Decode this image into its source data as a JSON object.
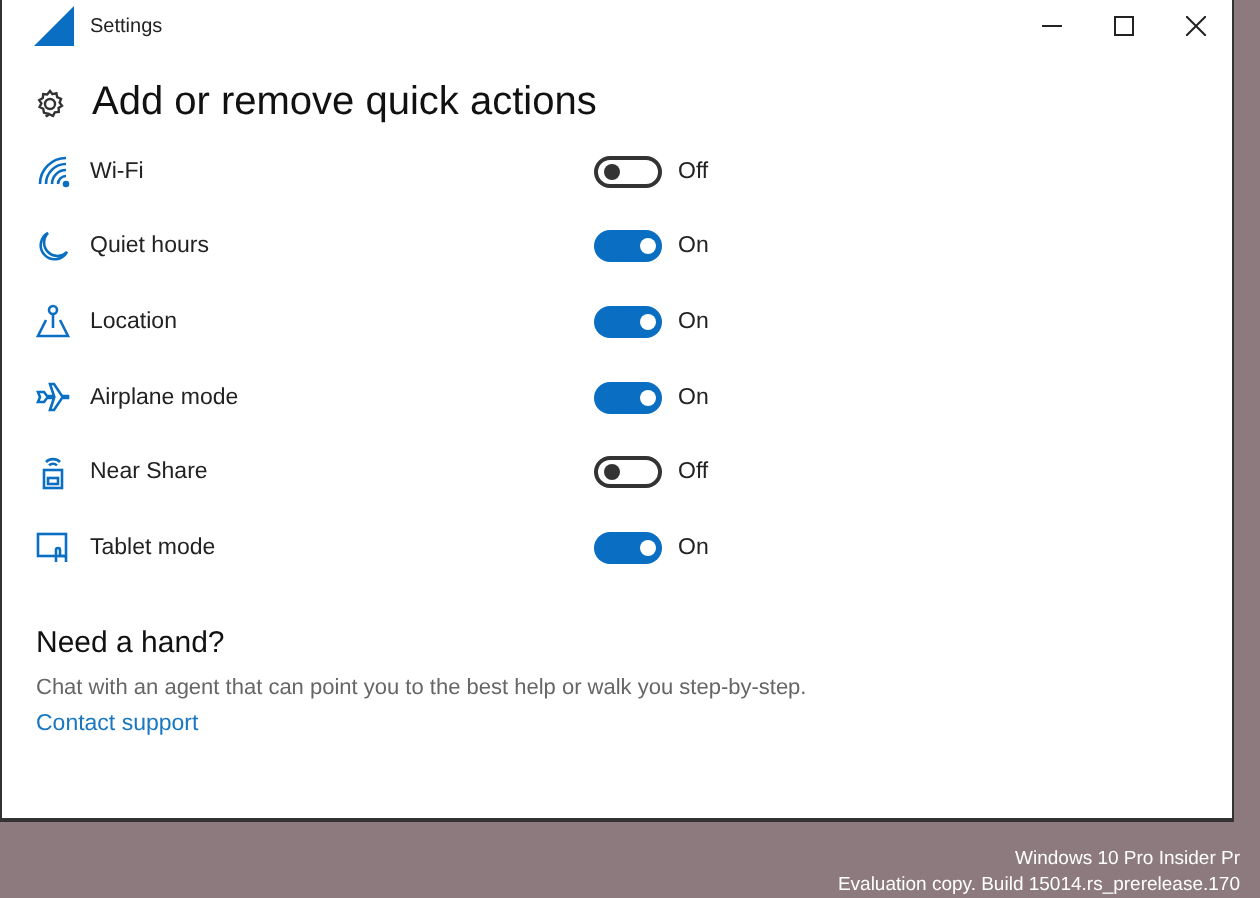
{
  "window": {
    "title": "Settings"
  },
  "page": {
    "title": "Add or remove quick actions"
  },
  "quick_actions": [
    {
      "kind": "wifi",
      "label": "Wi-Fi",
      "on": false,
      "state_text": "Off"
    },
    {
      "kind": "moon",
      "label": "Quiet hours",
      "on": true,
      "state_text": "On"
    },
    {
      "kind": "location",
      "label": "Location",
      "on": true,
      "state_text": "On"
    },
    {
      "kind": "airplane",
      "label": "Airplane mode",
      "on": true,
      "state_text": "On"
    },
    {
      "kind": "share",
      "label": "Near Share",
      "on": false,
      "state_text": "Off"
    },
    {
      "kind": "tablet",
      "label": "Tablet mode",
      "on": true,
      "state_text": "On"
    }
  ],
  "help": {
    "title": "Need a hand?",
    "text": "Chat with an agent that can point you to the best help or walk you step-by-step.",
    "link": "Contact support"
  },
  "desktop": {
    "watermark_lines": [
      "Windows 10 Pro Insider Pr",
      "Evaluation copy. Build 15014.rs_prerelease.170"
    ]
  }
}
